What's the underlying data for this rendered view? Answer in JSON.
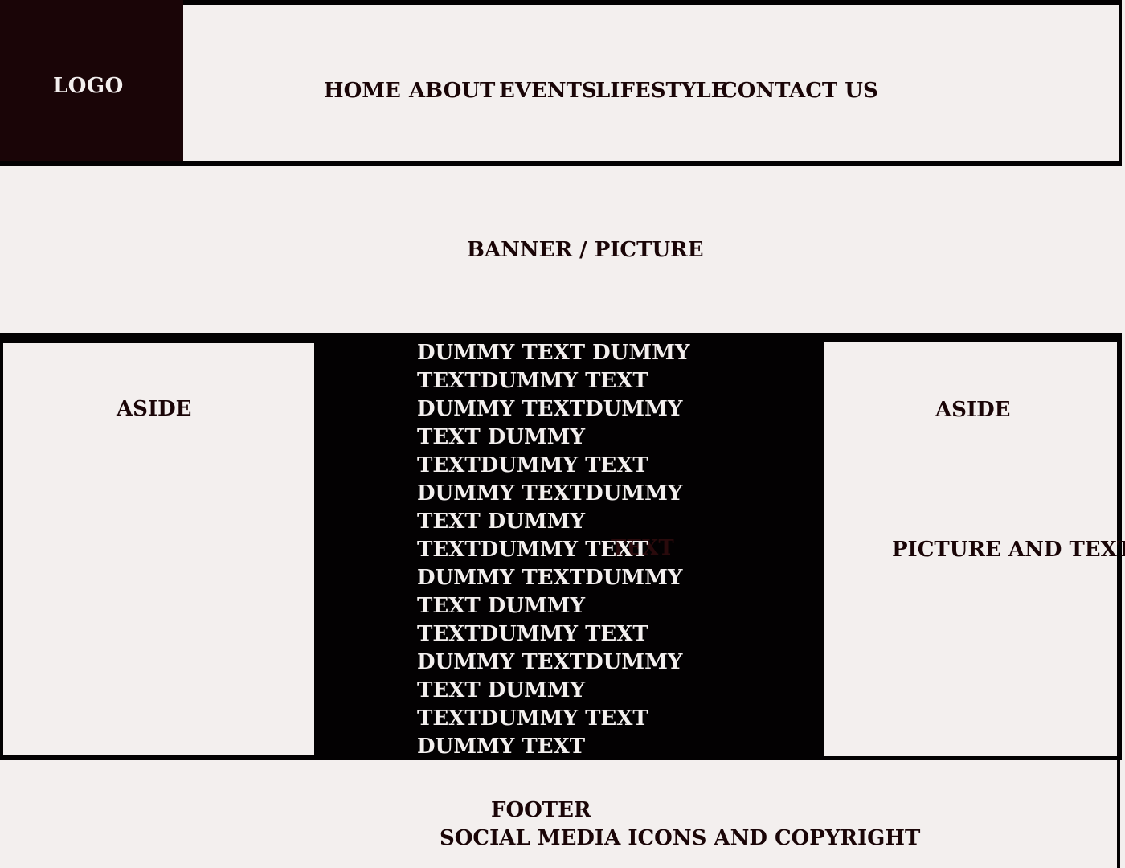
{
  "header": {
    "logo": "LOGO",
    "nav": [
      "HOME",
      "ABOUT",
      "EVENTS",
      "LIFESTYLE",
      "CONTACT US"
    ]
  },
  "banner": {
    "label": "BANNER / PICTURE"
  },
  "aside_left": {
    "label": "ASIDE"
  },
  "content": {
    "lines": [
      "DUMMY TEXT DUMMY",
      "TEXTDUMMY TEXT",
      "DUMMY TEXTDUMMY",
      "TEXT DUMMY",
      "TEXTDUMMY TEXT",
      "DUMMY TEXTDUMMY",
      "TEXT DUMMY",
      "TEXTDUMMY TEXT",
      "DUMMY TEXTDUMMY",
      "TEXT DUMMY",
      "TEXTDUMMY TEXT",
      "DUMMY TEXTDUMMY",
      "TEXT DUMMY",
      "TEXTDUMMY TEXT",
      "DUMMY TEXT"
    ],
    "ghost": "TEXT"
  },
  "aside_right": {
    "label": "ASIDE",
    "sub": "PICTURE AND TEXT"
  },
  "footer": {
    "title": "FOOTER",
    "sub": "SOCIAL MEDIA ICONS AND COPYRIGHT"
  },
  "colors": {
    "dark": "#030102",
    "logo_bg": "#1a0507",
    "light": "#f3efee"
  }
}
